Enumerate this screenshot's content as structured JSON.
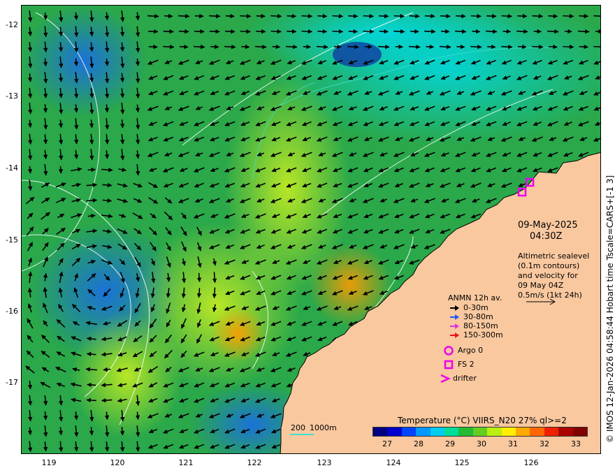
{
  "map": {
    "date": "09-May-2025",
    "time": "04:30Z",
    "description_lines": [
      "Altimetric sealevel",
      "(0.1m contours)",
      "and velocity for",
      "09 May 04Z",
      "0.5m/s (1kt 24h)"
    ],
    "credit": "© IMOS 12-Jan-2026 04:58:44 Hobart time Tscale=CARS+[-1 3]",
    "lon_ticks": [
      "119",
      "120",
      "121",
      "122",
      "123",
      "124",
      "125",
      "126"
    ],
    "lat_ticks": [
      "-12",
      "-13",
      "-14",
      "-15",
      "-16",
      "-17"
    ],
    "depth_contour_label": [
      "200",
      "1000m"
    ]
  },
  "legend": {
    "title": "ANMN 12h av.",
    "items": [
      {
        "label": "0-30m",
        "color": "#000000"
      },
      {
        "label": "30-80m",
        "color": "#2255ff"
      },
      {
        "label": "80-150m",
        "color": "#dd33dd"
      },
      {
        "label": "150-300m",
        "color": "#ee1111"
      }
    ],
    "markers": [
      {
        "label": "Argo 0",
        "shape": "circle-icon",
        "color": "#ee00ee"
      },
      {
        "label": "FS 2",
        "shape": "square-icon",
        "color": "#ee00ee"
      },
      {
        "label": "drifter",
        "shape": "chevron-icon",
        "color": "#ee00ee"
      }
    ]
  },
  "colorbar": {
    "title": "Temperature (°C) VIIRS_N20 27% ql>=2",
    "ticks": [
      "27",
      "28",
      "29",
      "30",
      "31",
      "32",
      "33"
    ],
    "colors": [
      "#000080",
      "#0000cc",
      "#0044ff",
      "#0099ff",
      "#00ccee",
      "#00dd99",
      "#22bb33",
      "#66cc22",
      "#bbee11",
      "#ffee00",
      "#ffaa00",
      "#ff6600",
      "#ee2200",
      "#aa0000",
      "#800000"
    ]
  },
  "colors": {
    "land": "#f9c89f",
    "ocean_base": "#2aa84a",
    "sealevel_contour": "#ffffff",
    "depth_contour": "#40e0d0",
    "site_marker": "#ee00ee"
  }
}
